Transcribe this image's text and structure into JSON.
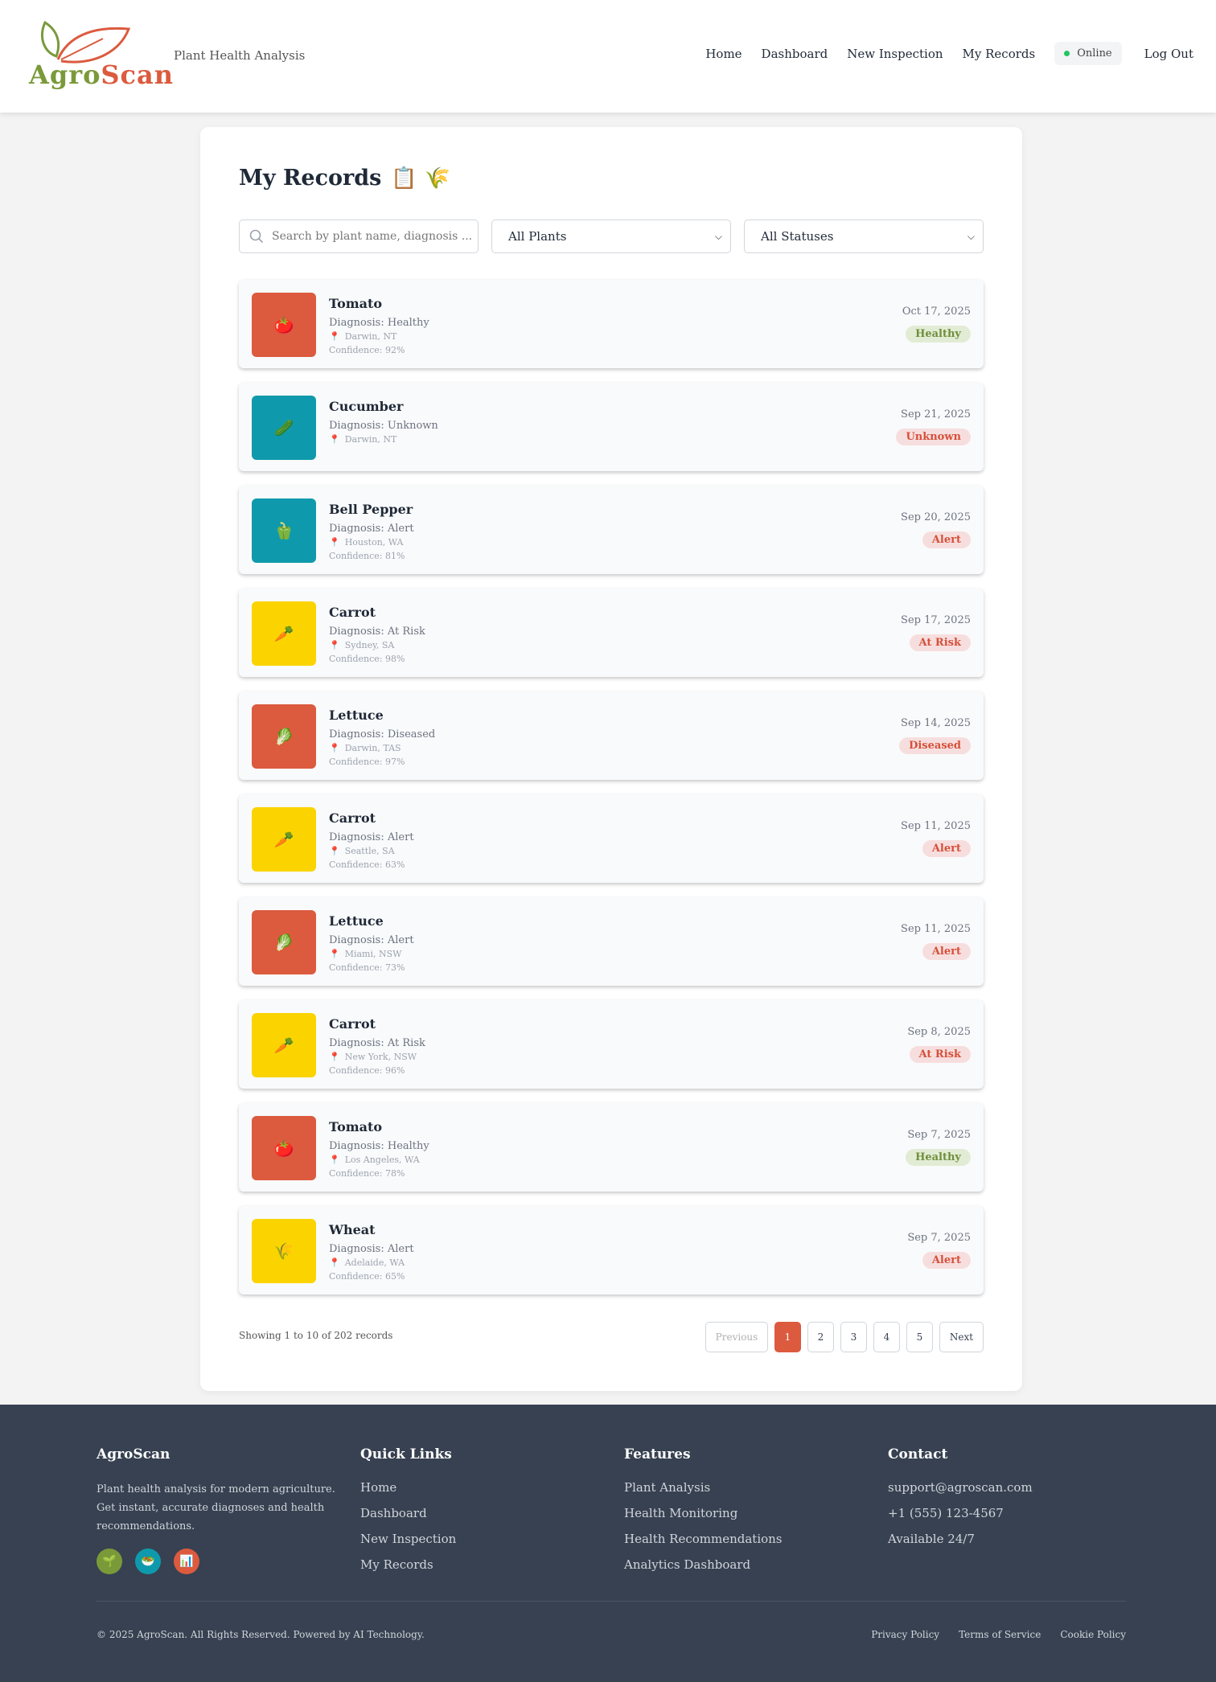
{
  "header": {
    "logo": {
      "part1": "Agro",
      "part2": "Scan"
    },
    "tagline": "Plant Health Analysis",
    "nav": [
      "Home",
      "Dashboard",
      "New Inspection",
      "My Records"
    ],
    "status": "Online",
    "logout": "Log Out"
  },
  "page": {
    "title": "My Records",
    "title_emoji": "📋 🌾",
    "search_placeholder": "Search by plant name, diagnosis ...",
    "plant_filter": "All Plants",
    "status_filter": "All Statuses"
  },
  "records": [
    {
      "name": "Tomato",
      "diagnosis": "Diagnosis: Healthy",
      "location": "Darwin, NT",
      "confidence": "Confidence: 92%",
      "date": "Oct 17, 2025",
      "status": "Healthy",
      "emoji": "🍅",
      "color": "#dc5a3e"
    },
    {
      "name": "Cucumber",
      "diagnosis": "Diagnosis: Unknown",
      "location": "Darwin, NT",
      "confidence": "",
      "date": "Sep 21, 2025",
      "status": "Unknown",
      "emoji": "🥒",
      "color": "#0e9aac"
    },
    {
      "name": "Bell Pepper",
      "diagnosis": "Diagnosis: Alert",
      "location": "Houston, WA",
      "confidence": "Confidence: 81%",
      "date": "Sep 20, 2025",
      "status": "Alert",
      "emoji": "🫑",
      "color": "#0e9aac"
    },
    {
      "name": "Carrot",
      "diagnosis": "Diagnosis: At Risk",
      "location": "Sydney, SA",
      "confidence": "Confidence: 98%",
      "date": "Sep 17, 2025",
      "status": "At Risk",
      "emoji": "🥕",
      "color": "#fbd400"
    },
    {
      "name": "Lettuce",
      "diagnosis": "Diagnosis: Diseased",
      "location": "Darwin, TAS",
      "confidence": "Confidence: 97%",
      "date": "Sep 14, 2025",
      "status": "Diseased",
      "emoji": "🥬",
      "color": "#dc5a3e"
    },
    {
      "name": "Carrot",
      "diagnosis": "Diagnosis: Alert",
      "location": "Seattle, SA",
      "confidence": "Confidence: 63%",
      "date": "Sep 11, 2025",
      "status": "Alert",
      "emoji": "🥕",
      "color": "#fbd400"
    },
    {
      "name": "Lettuce",
      "diagnosis": "Diagnosis: Alert",
      "location": "Miami, NSW",
      "confidence": "Confidence: 73%",
      "date": "Sep 11, 2025",
      "status": "Alert",
      "emoji": "🥬",
      "color": "#dc5a3e"
    },
    {
      "name": "Carrot",
      "diagnosis": "Diagnosis: At Risk",
      "location": "New York, NSW",
      "confidence": "Confidence: 96%",
      "date": "Sep 8, 2025",
      "status": "At Risk",
      "emoji": "🥕",
      "color": "#fbd400"
    },
    {
      "name": "Tomato",
      "diagnosis": "Diagnosis: Healthy",
      "location": "Los Angeles, WA",
      "confidence": "Confidence: 78%",
      "date": "Sep 7, 2025",
      "status": "Healthy",
      "emoji": "🍅",
      "color": "#dc5a3e"
    },
    {
      "name": "Wheat",
      "diagnosis": "Diagnosis: Alert",
      "location": "Adelaide, WA",
      "confidence": "Confidence: 65%",
      "date": "Sep 7, 2025",
      "status": "Alert",
      "emoji": "🌾",
      "color": "#fbd400"
    }
  ],
  "pagination": {
    "showing": "Showing 1 to 10 of 202 records",
    "previous": "Previous",
    "pages": [
      "1",
      "2",
      "3",
      "4",
      "5"
    ],
    "active": "1",
    "next": "Next"
  },
  "footer": {
    "brand": "AgroScan",
    "description": "Plant health analysis for modern agriculture. Get instant, accurate diagnoses and health recommendations.",
    "social": [
      {
        "icon": "🌱",
        "color": "#7a9a3a"
      },
      {
        "icon": "🥗",
        "color": "#0e9aac"
      },
      {
        "icon": "📊",
        "color": "#dc5a3e"
      }
    ],
    "quick_links_title": "Quick Links",
    "quick_links": [
      "Home",
      "Dashboard",
      "New Inspection",
      "My Records"
    ],
    "features_title": "Features",
    "features": [
      "Plant Analysis",
      "Health Monitoring",
      "Health Recommendations",
      "Analytics Dashboard"
    ],
    "contact_title": "Contact",
    "contact": [
      "support@agroscan.com",
      "+1 (555) 123-4567",
      "Available 24/7"
    ],
    "copyright": "© 2025 AgroScan. All Rights Reserved. Powered by AI Technology.",
    "legal": [
      "Privacy Policy",
      "Terms of Service",
      "Cookie Policy"
    ]
  }
}
